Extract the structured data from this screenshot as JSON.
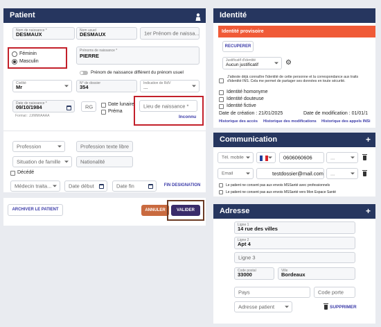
{
  "patient": {
    "title": "Patient",
    "nom_naissance": {
      "label": "Nom de naissance *",
      "value": "DESMAUX"
    },
    "nom_usuel": {
      "label": "Nom usuel",
      "value": "DESMAUX"
    },
    "prenom_naissance_1": {
      "placeholder": "1er Prénom de naissa..."
    },
    "sexe": {
      "feminin": "Féminin",
      "masculin": "Masculin",
      "selected": "Masculin"
    },
    "prenom_naissance": {
      "label": "Prénoms de naissance *",
      "value": "PIERRE"
    },
    "prenom_usuel_toggle": "Prénom de naissance différent du prénom usuel",
    "civilite": {
      "label": "Civilité",
      "value": "Mr"
    },
    "dossier": {
      "label": "N° de dossier",
      "value": "354"
    },
    "indication_rdv": {
      "label": "Indication de RdV",
      "value": "..."
    },
    "date_naissance": {
      "label": "Date de naissance *",
      "value": "09/10/1984",
      "format": "Format : JJ/MM/AAAA"
    },
    "rg": "RG",
    "date_lunaire": "Date lunaire",
    "prema": "Préma",
    "lieu_naissance": {
      "placeholder": "Lieu de naissance *",
      "status": "Inconnu"
    },
    "profession": "Profession",
    "profession_libre": "Profession texte libre",
    "situation_famille": "Situation de famille",
    "nationalite": "Nationalité",
    "decede": "Décédé",
    "medecin_traitant": "Médecin traita...",
    "date_debut": "Date début",
    "date_fin": "Date fin",
    "fin_designation": "FIN DESIGNATION",
    "archiver": "ARCHIVER LE PATIENT",
    "annuler": "ANNULER",
    "valider": "VALIDER"
  },
  "identite": {
    "title": "Identité",
    "banner": "Identité provisoire",
    "recuperer": "RECUPERER",
    "justificatif": {
      "label": "Justificatif d'identité",
      "value": "Aucun justificatif"
    },
    "attestation": "J'atteste déjà connaître l'identité de cette personne et la correspondance aux traits d'identité INS. Cela me permet de partager ses données en toute sécurité.",
    "homonyme": "Identité homonyme",
    "douteuse": "Identité douteuse",
    "fictive": "Identité fictive",
    "date_creation": "Date de création : 21/01/2025",
    "date_modification": "Date de modification : 01/01/1",
    "hist_acces": "Historique des accès",
    "hist_modifications": "Historique des modifications",
    "hist_appels": "Historique des appels INSi"
  },
  "communication": {
    "title": "Communication",
    "tel_type": "Tél. mobile",
    "tel_value": "0606060606",
    "tel_extra": "...",
    "email_type": "Email",
    "email_value": "testdossier@mail.com",
    "email_extra": "...",
    "consent_pro": "Le patient ne consent pas aux envois MSSanté avec professionnels",
    "consent_espace": "Le patient ne consent pas aux envois MSSanté vers Mon Espace Santé"
  },
  "adresse": {
    "title": "Adresse",
    "ligne1": {
      "label": "Ligne 1",
      "value": "14 rue des villes"
    },
    "ligne2": {
      "label": "Ligne 2",
      "value": "Apt 4"
    },
    "ligne3": "Ligne 3",
    "code_postal": {
      "label": "Code postal",
      "value": "33000"
    },
    "ville": {
      "label": "Ville",
      "value": "Bordeaux"
    },
    "pays": "Pays",
    "code_porte": "Code porte",
    "type_adresse": "Adresse patient",
    "supprimer": "SUPPRIMER"
  },
  "colors": {
    "header": "#26365f",
    "banner": "#f05a37",
    "highlight": "#c3202a",
    "valider": "#3a2c6b",
    "annuler": "#c96a3f"
  },
  "icons": [
    "person-icon",
    "calendar-icon",
    "gear-icon",
    "trash-icon",
    "plus-icon",
    "france-flag-icon"
  ]
}
